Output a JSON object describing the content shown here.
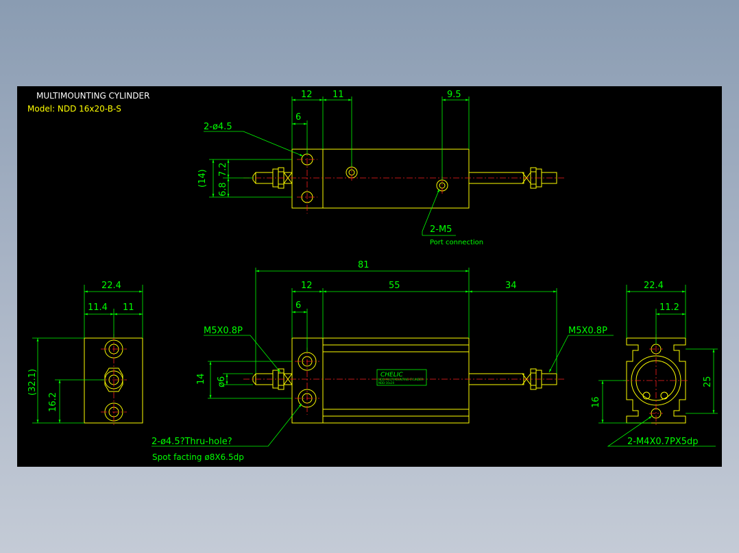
{
  "header": {
    "title": "MULTIMOUNTING CYLINDER",
    "model": "Model: NDD 16x20-B-S"
  },
  "top_view": {
    "dims": {
      "d12": "12",
      "d11": "11",
      "d9_5": "9.5",
      "d6": "6",
      "d14": "(14)",
      "d7_2": "7.2",
      "d6_8": "6.8"
    },
    "hole_callout": "2-ø4.5",
    "port_callout": "2-M5",
    "port_note": "Port connection"
  },
  "front_view": {
    "dims": {
      "d81": "81",
      "d12": "12",
      "d55": "55",
      "d34": "34",
      "d6": "6",
      "d14": "14",
      "d_phi6": "ø6"
    },
    "thread_left": "M5X0.8P",
    "thread_right": "M5X0.8P",
    "hole_callout": "2-ø4.5?Thru-hole?",
    "spot_facing": "Spot facting  ø8X6.5dp",
    "brand": "CHELIC",
    "label_line1": "NDD MULTIMOUNTING CYLINDER",
    "label_line2": "NDD-16x20"
  },
  "left_view": {
    "dims": {
      "d22_4": "22.4",
      "d11_4": "11.4",
      "d11": "11",
      "d32_1": "(32.1)",
      "d16_2": "16.2"
    }
  },
  "right_view": {
    "dims": {
      "d22_4": "22.4",
      "d11_2": "11.2",
      "d25": "25",
      "d16": "16"
    },
    "tap_callout": "2-M4X0.7PX5dp"
  }
}
